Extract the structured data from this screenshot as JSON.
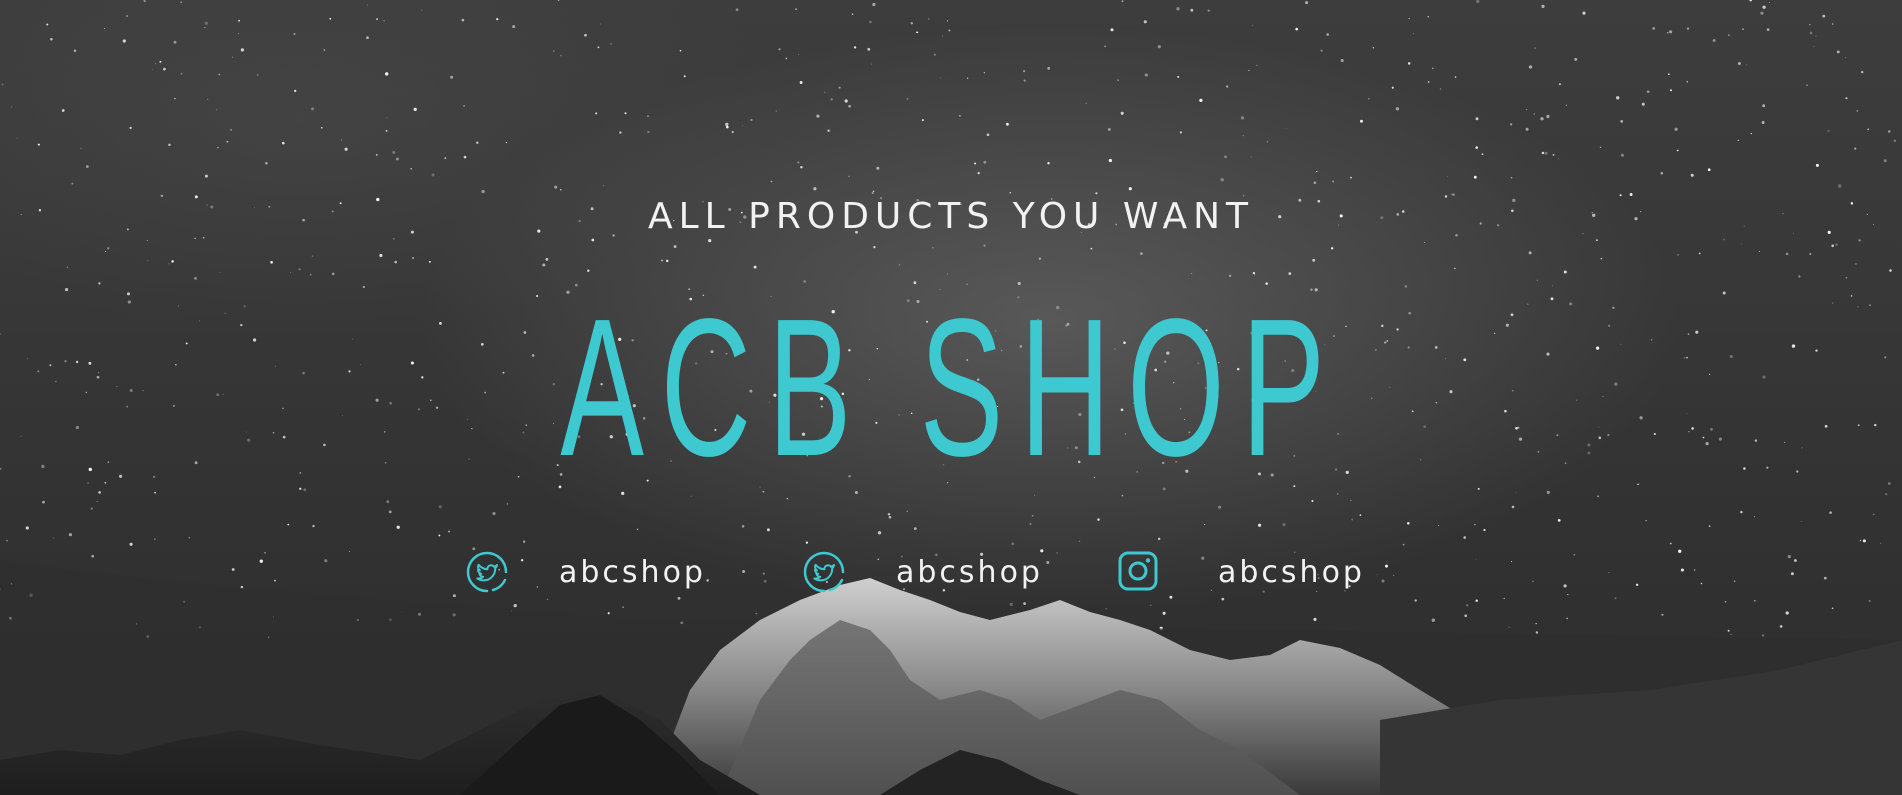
{
  "banner": {
    "tagline": "ALL PRODUCTS YOU WANT",
    "title": "ACB SHOP",
    "accent_color": "#3ec9d1",
    "socials": [
      {
        "icon": "twitter-icon",
        "handle": "abcshop"
      },
      {
        "icon": "twitter-icon",
        "handle": "abcshop"
      },
      {
        "icon": "instagram-icon",
        "handle": "abcshop"
      }
    ]
  }
}
